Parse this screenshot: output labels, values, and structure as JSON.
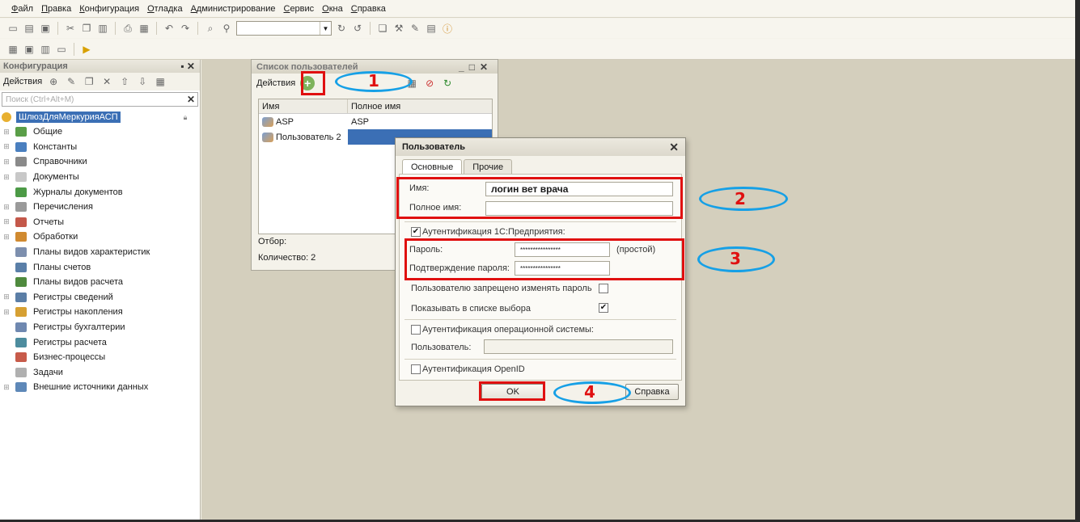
{
  "menu": [
    "Файл",
    "Правка",
    "Конфигурация",
    "Отладка",
    "Администрирование",
    "Сервис",
    "Окна",
    "Справка"
  ],
  "config_panel": {
    "title": "Конфигурация",
    "actions_label": "Действия",
    "search_placeholder": "Поиск (Ctrl+Alt+M)",
    "root_label": "ШлюзДляМеркурияАСП",
    "items": [
      {
        "label": "Общие",
        "icon": "common-icon",
        "color": "#5a9e48",
        "expandable": true
      },
      {
        "label": "Константы",
        "icon": "constants-icon",
        "color": "#4a7fbf",
        "expandable": true
      },
      {
        "label": "Справочники",
        "icon": "catalogs-icon",
        "color": "#8a8a8a",
        "expandable": true
      },
      {
        "label": "Документы",
        "icon": "documents-icon",
        "color": "#c8c8c8",
        "expandable": true
      },
      {
        "label": "Журналы документов",
        "icon": "journals-icon",
        "color": "#4c9a46",
        "expandable": false
      },
      {
        "label": "Перечисления",
        "icon": "enums-icon",
        "color": "#9a9a9a",
        "expandable": true
      },
      {
        "label": "Отчеты",
        "icon": "reports-icon",
        "color": "#c4584a",
        "expandable": true
      },
      {
        "label": "Обработки",
        "icon": "processing-icon",
        "color": "#d08a30",
        "expandable": true
      },
      {
        "label": "Планы видов характеристик",
        "icon": "char-plans-icon",
        "color": "#7d8fae",
        "expandable": false
      },
      {
        "label": "Планы счетов",
        "icon": "accounts-plans-icon",
        "color": "#5a7fa8",
        "expandable": false
      },
      {
        "label": "Планы видов расчета",
        "icon": "calc-plans-icon",
        "color": "#4f8a3e",
        "expandable": false
      },
      {
        "label": "Регистры сведений",
        "icon": "info-registers-icon",
        "color": "#5b7ea6",
        "expandable": true
      },
      {
        "label": "Регистры накопления",
        "icon": "accum-registers-icon",
        "color": "#d6a033",
        "expandable": true
      },
      {
        "label": "Регистры бухгалтерии",
        "icon": "acc-registers-icon",
        "color": "#6f88b0",
        "expandable": false
      },
      {
        "label": "Регистры расчета",
        "icon": "calc-registers-icon",
        "color": "#4d8c9e",
        "expandable": false
      },
      {
        "label": "Бизнес-процессы",
        "icon": "business-processes-icon",
        "color": "#c75b4a",
        "expandable": false
      },
      {
        "label": "Задачи",
        "icon": "tasks-icon",
        "color": "#b0b0b0",
        "expandable": false
      },
      {
        "label": "Внешние источники данных",
        "icon": "external-sources-icon",
        "color": "#5e88b8",
        "expandable": true
      }
    ]
  },
  "users_list": {
    "title": "Список пользователей",
    "actions_label": "Действия",
    "columns": [
      "Имя",
      "Полное имя"
    ],
    "rows": [
      {
        "name": "ASP",
        "full_name": "ASP"
      },
      {
        "name": "Пользователь 2",
        "full_name": ""
      }
    ],
    "filter_label": "Отбор:",
    "count_label": "Количество: 2"
  },
  "user_dialog": {
    "title": "Пользователь",
    "tabs": [
      "Основные",
      "Прочие"
    ],
    "name_label": "Имя:",
    "name_value": "логин вет врача",
    "fullname_label": "Полное имя:",
    "fullname_value": "",
    "auth_1c_label": "Аутентификация 1С:Предприятия:",
    "auth_1c_checked": true,
    "password_label": "Пароль:",
    "password_value": "****************",
    "password_strength": "(простой)",
    "confirm_label": "Подтверждение пароля:",
    "confirm_value": "****************",
    "deny_change_label": "Пользователю запрещено изменять пароль",
    "deny_change_checked": false,
    "show_in_list_label": "Показывать в списке выбора",
    "show_in_list_checked": true,
    "os_auth_label": "Аутентификация операционной системы:",
    "os_auth_checked": false,
    "os_user_label": "Пользователь:",
    "os_user_value": "",
    "openid_label": "Аутентификация OpenID",
    "openid_checked": false,
    "ok_label": "OK",
    "help_label": "Справка"
  },
  "annotations": [
    "1",
    "2",
    "3",
    "4"
  ],
  "colors": {
    "annotation_red": "#e01010",
    "annotation_blue": "#16a0e6",
    "selection": "#3b6fb5"
  }
}
